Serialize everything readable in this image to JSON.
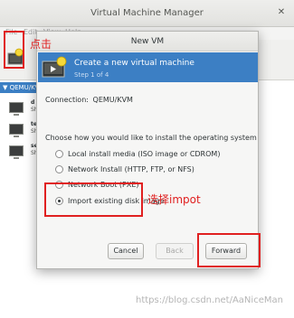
{
  "main_window": {
    "title": "Virtual Machine Manager",
    "menu": [
      "File",
      "Edit",
      "View",
      "Help"
    ],
    "connection_header": "QEMU/KVM",
    "vms": [
      {
        "name": "d",
        "state": "Sh"
      },
      {
        "name": "te",
        "state": "Sh"
      },
      {
        "name": "se",
        "state": "Sh"
      }
    ]
  },
  "dialog": {
    "title": "New VM",
    "banner_title": "Create a new virtual machine",
    "banner_step": "Step 1 of 4",
    "connection_label": "Connection:",
    "connection_value": "QEMU/KVM",
    "choose_label": "Choose how you would like to install the operating system",
    "options": [
      {
        "label": "Local install media (ISO image or CDROM)",
        "checked": false
      },
      {
        "label": "Network Install (HTTP, FTP, or NFS)",
        "checked": false
      },
      {
        "label": "Network Boot (PXE)",
        "checked": false
      },
      {
        "label": "Import existing disk image",
        "checked": true
      }
    ],
    "buttons": {
      "cancel": "Cancel",
      "back": "Back",
      "forward": "Forward"
    }
  },
  "annotations": {
    "click_label": "点击",
    "select_label": "选择impot",
    "color": "#e02020"
  },
  "watermark": "https://blog.csdn.net/AaNiceMan"
}
